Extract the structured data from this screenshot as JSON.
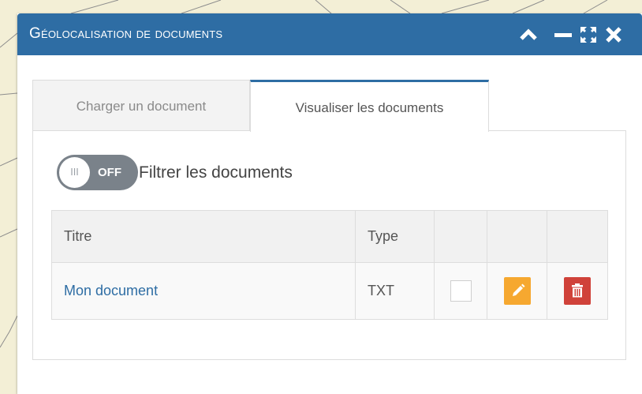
{
  "window": {
    "title": "Géolocalisation de documents",
    "controls": [
      "chevron-up-icon",
      "minus-icon",
      "expand-icon",
      "close-icon"
    ]
  },
  "tabs": [
    {
      "label": "Charger un document",
      "active": false
    },
    {
      "label": "Visualiser les documents",
      "active": true
    }
  ],
  "filter": {
    "toggle_state": "OFF",
    "toggle_knob": "III",
    "label": "Filtrer les documents"
  },
  "table": {
    "columns": [
      "Titre",
      "Type",
      "",
      "",
      ""
    ],
    "rows": [
      {
        "title": "Mon document",
        "type": "TXT",
        "checked": false
      }
    ]
  },
  "colors": {
    "titlebar": "#2e6da4",
    "edit_button": "#f6a830",
    "delete_button": "#d0423a",
    "toggle_off": "#7a828a",
    "link": "#2e6da4",
    "map_background": "#f3efd6"
  }
}
